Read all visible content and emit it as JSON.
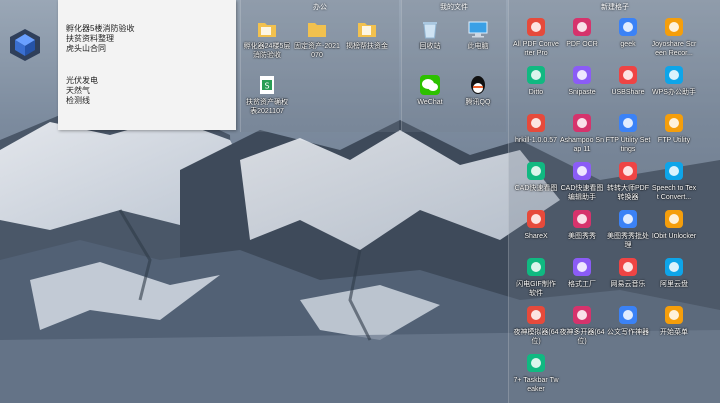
{
  "note": {
    "group1": [
      "孵化器5楼消防验收",
      "扶贫资料整理",
      "虎头山合同"
    ],
    "group2": [
      "光伏发电",
      "天然气",
      "检测线"
    ]
  },
  "fences": {
    "office": {
      "title": "办公",
      "items": [
        {
          "label": "孵化器24楼5层消防验收",
          "icon": "folder-icon"
        },
        {
          "label": "固定资产-2021070",
          "icon": "folder-icon"
        },
        {
          "label": "揭榜帮扶资金",
          "icon": "folder-icon"
        },
        {
          "label": "扶贫资产确权表2021107",
          "icon": "excel-file-icon"
        }
      ]
    },
    "docs": {
      "title": "我的文件",
      "items": [
        {
          "label": "回收站",
          "icon": "recycle-bin-icon"
        },
        {
          "label": "此电脑",
          "icon": "computer-icon"
        },
        {
          "label": "WeChat",
          "icon": "wechat-icon"
        },
        {
          "label": "腾讯QQ",
          "icon": "qq-icon"
        }
      ]
    },
    "new": {
      "title": "新建格子",
      "items": [
        {
          "label": "All PDF Converter Pro",
          "icon": "pdf-converter-icon"
        },
        {
          "label": "PDF OCR",
          "icon": "pdf-ocr-icon"
        },
        {
          "label": "geek",
          "icon": "geek-icon"
        },
        {
          "label": "Joyoshare Screen Recor...",
          "icon": "screen-recorder-icon"
        },
        {
          "label": "Ditto",
          "icon": "ditto-icon"
        },
        {
          "label": "Snipaste",
          "icon": "snipaste-icon"
        },
        {
          "label": "USBShare",
          "icon": "usbshare-icon"
        },
        {
          "label": "WPS办公助手",
          "icon": "wps-icon"
        },
        {
          "label": "hrkill-1.0.0.57",
          "icon": "shield-icon"
        },
        {
          "label": "Ashampoo Snap 11",
          "icon": "ashampoo-icon"
        },
        {
          "label": "FTP Utility Settings",
          "icon": "ftp-settings-icon"
        },
        {
          "label": "FTP Utility",
          "icon": "ftp-icon"
        },
        {
          "label": "CAD快速看图",
          "icon": "cad-icon"
        },
        {
          "label": "CAD快速看图编辑助手",
          "icon": "cad-edit-icon"
        },
        {
          "label": "转转大师PDF转换器",
          "icon": "pdf-converter-z-icon"
        },
        {
          "label": "Speech to Text Convert...",
          "icon": "speech-icon"
        },
        {
          "label": "ShareX",
          "icon": "sharex-icon"
        },
        {
          "label": "美图秀秀",
          "icon": "meitu-icon"
        },
        {
          "label": "美图秀秀批处理",
          "icon": "meitu-batch-icon"
        },
        {
          "label": "IObit Unlocker",
          "icon": "unlocker-icon"
        },
        {
          "label": "闪电GIF制作软件",
          "icon": "gif-icon"
        },
        {
          "label": "格式工厂",
          "icon": "format-factory-icon"
        },
        {
          "label": "网易云音乐",
          "icon": "netease-music-icon"
        },
        {
          "label": "阿里云盘",
          "icon": "aliyun-drive-icon"
        },
        {
          "label": "夜神模拟器(64位)",
          "icon": "nox-icon"
        },
        {
          "label": "夜神多开器(64位)",
          "icon": "nox-multi-icon"
        },
        {
          "label": "公文写作神器",
          "icon": "writing-icon"
        },
        {
          "label": "开始菜单",
          "icon": "start-menu-icon"
        },
        {
          "label": "7+ Taskbar Tweaker",
          "icon": "taskbar-tweaker-icon"
        }
      ]
    }
  },
  "colors": {
    "sky": "#5f7690",
    "rock": "#3e4a5a",
    "snow": "#e6ebf2"
  }
}
